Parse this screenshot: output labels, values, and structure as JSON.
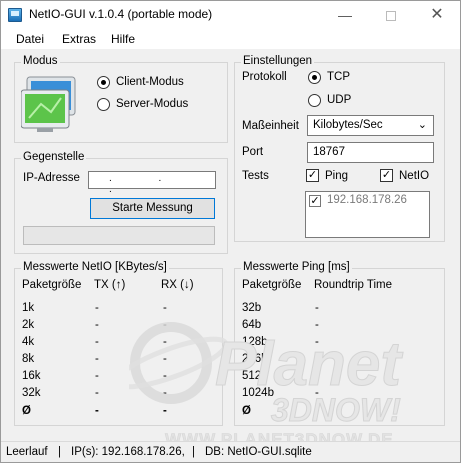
{
  "window": {
    "title": "NetIO-GUI v.1.0.4 (portable mode)"
  },
  "titlebar": {
    "minimize": "—",
    "close": "✕"
  },
  "menu": [
    "Datei",
    "Extras",
    "Hilfe"
  ],
  "modus": {
    "title": "Modus",
    "client_label": "Client-Modus",
    "server_label": "Server-Modus",
    "selected": "client"
  },
  "gegenstelle": {
    "title": "Gegenstelle",
    "ip_label": "IP-Adresse",
    "ip_value": ". . .",
    "start_button": "Starte Messung"
  },
  "einstellungen": {
    "title": "Einstellungen",
    "protokoll_label": "Protokoll",
    "tcp_label": "TCP",
    "udp_label": "UDP",
    "protocol_selected": "TCP",
    "masseinheit_label": "Maßeinheit",
    "masseinheit_value": "Kilobytes/Sec",
    "port_label": "Port",
    "port_value": "18767",
    "tests_label": "Tests",
    "ping_label": "Ping",
    "netio_label": "NetIO",
    "ping_checked": true,
    "netio_checked": true,
    "hosts": [
      {
        "ip": "192.168.178.26",
        "checked": true
      }
    ]
  },
  "netio_results": {
    "title": "Messwerte NetIO [KBytes/s]",
    "headers": [
      "Paketgröße",
      "TX (↑)",
      "RX (↓)"
    ],
    "rows": [
      [
        "1k",
        "-",
        "-"
      ],
      [
        "2k",
        "-",
        "-"
      ],
      [
        "4k",
        "-",
        "-"
      ],
      [
        "8k",
        "-",
        "-"
      ],
      [
        "16k",
        "-",
        "-"
      ],
      [
        "32k",
        "-",
        "-"
      ]
    ],
    "avg": [
      "Ø",
      "-",
      "-"
    ]
  },
  "ping_results": {
    "title": "Messwerte Ping [ms]",
    "headers": [
      "Paketgröße",
      "Roundtrip Time"
    ],
    "rows": [
      [
        "32b",
        "-"
      ],
      [
        "64b",
        "-"
      ],
      [
        "128b",
        "-"
      ],
      [
        "256b",
        "-"
      ],
      [
        "512b",
        "-"
      ],
      [
        "1024b",
        "-"
      ]
    ],
    "avg": [
      "Ø",
      "-"
    ]
  },
  "status": {
    "state": "Leerlauf",
    "ips": "IP(s): 192.168.178.26,",
    "db": "DB: NetIO-GUI.sqlite",
    "separator": "|"
  },
  "watermark": {
    "line1": "Planet",
    "line2": "3DNOW!",
    "url": "WWW.PLANET3DNOW.DE"
  },
  "colors": {
    "accent": "#0078d7",
    "monitor_green": "#5cc44a",
    "monitor_blue": "#3a8fd8"
  },
  "icons": [
    "app-icon",
    "computers-icon",
    "chevron-down-icon",
    "check-icon"
  ]
}
